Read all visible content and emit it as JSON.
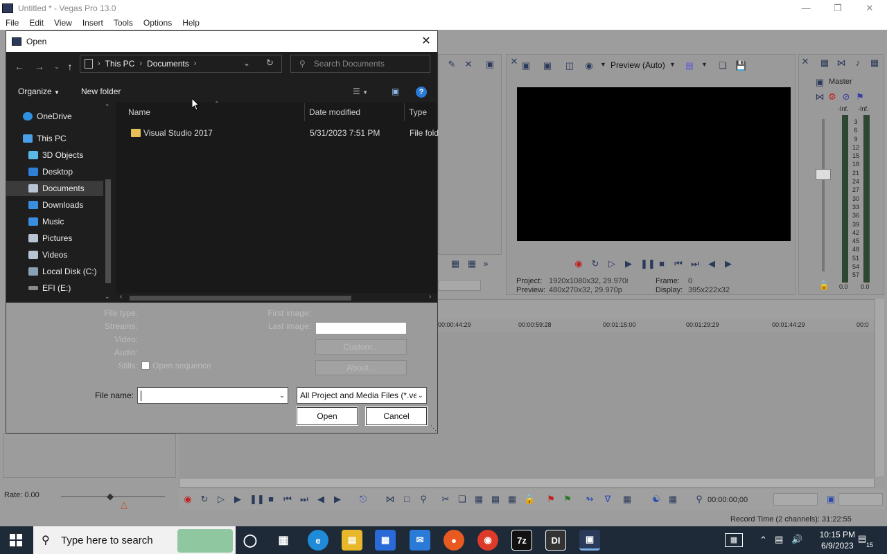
{
  "app": {
    "title": "Untitled * - Vegas Pro 13.0",
    "menu": [
      "File",
      "Edit",
      "View",
      "Insert",
      "Tools",
      "Options",
      "Help"
    ]
  },
  "preview": {
    "mode": "Preview (Auto)",
    "project_label": "Project:",
    "project_value": "1920x1080x32, 29.970i",
    "preview_label": "Preview:",
    "preview_value": "480x270x32, 29.970p",
    "frame_label": "Frame:",
    "frame_value": "0",
    "display_label": "Display:",
    "display_value": "395x222x32"
  },
  "mixer": {
    "title": "Master",
    "inf_left": "-Inf.",
    "inf_right": "-Inf.",
    "scale": [
      "3",
      "6",
      "9",
      "12",
      "15",
      "18",
      "21",
      "24",
      "27",
      "30",
      "33",
      "36",
      "39",
      "42",
      "45",
      "48",
      "51",
      "54",
      "57"
    ],
    "level_left": "0.0",
    "level_right": "0.0"
  },
  "timeline": {
    "ruler": [
      "00:00:44:29",
      "00:00:59:28",
      "00:01:15:00",
      "00:01:29:29",
      "00:01:44:29",
      "00:0"
    ],
    "rate": "Rate: 0.00",
    "timecode": "00:00:00;00",
    "record_time": "Record Time (2 channels): 31:22:55"
  },
  "taskbar": {
    "search_placeholder": "Type here to search",
    "time": "10:15 PM",
    "date": "6/9/2023",
    "notification_count": "15"
  },
  "dialog": {
    "title": "Open",
    "breadcrumb": [
      "This PC",
      "Documents"
    ],
    "search_placeholder": "Search Documents",
    "organize": "Organize",
    "new_folder": "New folder",
    "nav_items": [
      {
        "label": "OneDrive",
        "color": "#2f8fe0"
      },
      {
        "label": "This PC",
        "color": "#4aa0e8"
      },
      {
        "label": "3D Objects",
        "color": "#5ab8e8"
      },
      {
        "label": "Desktop",
        "color": "#2f7fd8"
      },
      {
        "label": "Documents",
        "color": "#b8c4d4"
      },
      {
        "label": "Downloads",
        "color": "#3a8ee0"
      },
      {
        "label": "Music",
        "color": "#3a8ee0"
      },
      {
        "label": "Pictures",
        "color": "#b8c4d4"
      },
      {
        "label": "Videos",
        "color": "#b8c4d4"
      },
      {
        "label": "Local Disk (C:)",
        "color": "#8aa0b8"
      },
      {
        "label": "EFI (E:)",
        "color": "#8a8a8a"
      }
    ],
    "columns": {
      "name": "Name",
      "date_modified": "Date modified",
      "type": "Type"
    },
    "files": [
      {
        "name": "Visual Studio 2017",
        "date_modified": "5/31/2023 7:51 PM",
        "type": "File fold"
      }
    ],
    "info": {
      "file_type": "File type:",
      "streams": "Streams:",
      "video": "Video:",
      "audio": "Audio:",
      "stills": "Stills:",
      "open_sequence": "Open sequence",
      "first_image": "First image:",
      "last_image": "Last image:",
      "custom": "Custom...",
      "about": "About..."
    },
    "file_name_label": "File name:",
    "file_type_filter": "All Project and Media Files (*.ve",
    "open_button": "Open",
    "cancel_button": "Cancel"
  }
}
